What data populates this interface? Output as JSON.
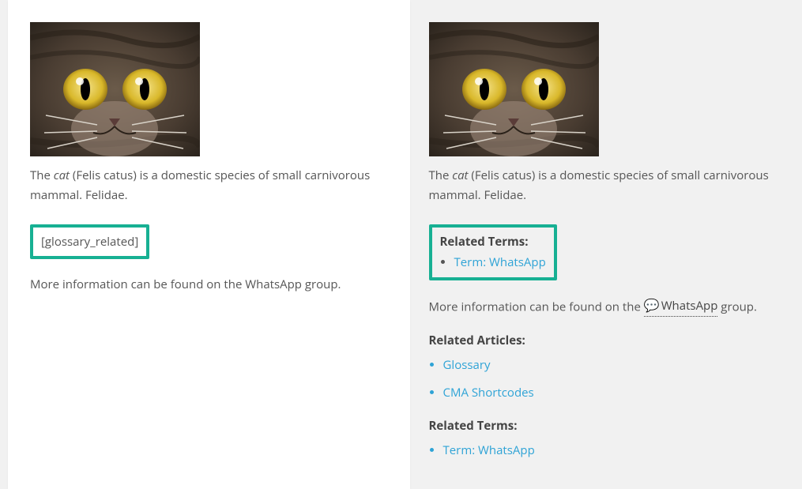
{
  "left": {
    "desc_pre": "The ",
    "desc_em": "cat",
    "desc_post": " (Felis catus) is a domestic species of small carnivorous mammal. Felidae.",
    "shortcode": "[glossary_related]",
    "info_line": "More information can be found on the WhatsApp group."
  },
  "right": {
    "desc_pre": "The ",
    "desc_em": "cat",
    "desc_post": " (Felis catus) is a domestic species of small carnivorous mammal. Felidae.",
    "related_terms_heading": "Related Terms:",
    "related_terms": [
      {
        "label": "Term: WhatsApp"
      }
    ],
    "info_pre": "More information can be found on the ",
    "info_link": "WhatsApp",
    "info_post": " group.",
    "related_articles_heading": "Related Articles:",
    "related_articles": [
      {
        "label": "Glossary"
      },
      {
        "label": "CMA Shortcodes"
      }
    ],
    "related_terms2_heading": "Related Terms:",
    "related_terms2": [
      {
        "label": "Term: WhatsApp"
      }
    ]
  }
}
